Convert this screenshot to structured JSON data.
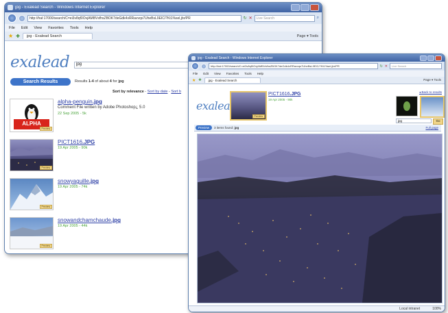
{
  "back_window": {
    "title": "jpg - Exalead Search - Windows Internet Explorer",
    "url": "http://hal:17000/search/C=ei3v8qf0OvjAMBVsfhsZBOK7deGdk4vRRavvqs7UheBsL9EIC/?Kt1%sel,jbr/PR",
    "search_placeholder": "Live Search",
    "menu": [
      "File",
      "Edit",
      "View",
      "Favorites",
      "Tools",
      "Help"
    ],
    "tab_label": "jpg - Exalead Search",
    "tools_label": "Page ▾ Tools",
    "logo": "exalead",
    "query": "jpg",
    "search_results_label": "Search Results",
    "results_prefix": "Results ",
    "results_range": "1-4",
    "results_mid": " of about ",
    "results_total": "4",
    "results_for": " for ",
    "results_query": "jpg",
    "sort_by": "Sort by relevance",
    "sort_date": "Sort by date",
    "sort_more": "Sort b",
    "badge": "Preview",
    "results": [
      {
        "name": "alpha-penguin",
        "ext": ".jpg",
        "desc": "Comment File written by Adobe Photoshop¿ 5.0",
        "meta": "22 Sep 2005 - 5k",
        "thumb_label": "ALPHA"
      },
      {
        "name": "PICT1616",
        "ext": ".JPG",
        "desc": "",
        "meta": "19 Apr 2005 - 90k",
        "thumb_label": ""
      },
      {
        "name": "snowyaguille",
        "ext": ".jpg",
        "desc": "",
        "meta": "19 Apr 2005 - 74k",
        "thumb_label": ""
      },
      {
        "name": "snowandchamchaude",
        "ext": ".jpg",
        "desc": "",
        "meta": "19 Apr 2005 - 44k",
        "thumb_label": ""
      }
    ]
  },
  "front_window": {
    "title": "jpg - Exalead Search - Windows Internet Explorer",
    "url": "http://hal:17000/search/C=ei3v8qf0OvjAMBVsfhsZBOK7deGdk4vRRavvqs7UheBsL9EIC/?Kt1%sel,jbr/PR",
    "search_placeholder": "Live Search",
    "menu": [
      "File",
      "Edit",
      "View",
      "Favorites",
      "Tools",
      "Help"
    ],
    "tab_label": "jpg - Exalead Search",
    "tools_label": "Page ▾ Tools",
    "logo": "exalead",
    "file_name": "PICT1616",
    "file_ext": ".JPG",
    "file_meta": "19 Apr 2005 - 90k",
    "back_link": "◂ Back to results",
    "query": "jpg",
    "go_label": "Go",
    "preview_tab": "Preview",
    "items_found_prefix": "3 items found: ",
    "items_found_query": "jpg",
    "full_page_link": "Full page",
    "status_zone": "Local intranet",
    "status_zoom": "100%"
  },
  "colors": {
    "accent_blue": "#3f63a4",
    "link_blue": "#2d3fa6",
    "meta_green": "#4aa33c",
    "badge_gold": "#f1d68a",
    "search_pill": "#3d74c9"
  }
}
